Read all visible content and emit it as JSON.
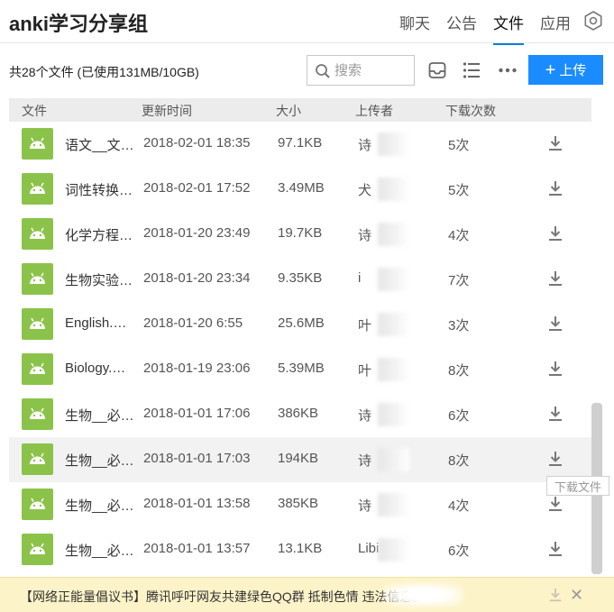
{
  "header": {
    "title": "anki学习分享组",
    "tabs": [
      "聊天",
      "公告",
      "文件",
      "应用"
    ],
    "active_tab": "文件",
    "accent_color": "#0b7fd9"
  },
  "toolbar": {
    "summary": "共28个文件 (已使用131MB/10GB)",
    "search_placeholder": "搜索",
    "upload_label": "上传",
    "upload_color": "#1a8cff",
    "icons": [
      "search-icon",
      "inbox-icon",
      "list-view-icon",
      "more-icon"
    ]
  },
  "columns": {
    "file": "文件",
    "updated": "更新时间",
    "size": "大小",
    "uploader": "上传者",
    "downloads": "下载次数"
  },
  "files": [
    {
      "name": "语文__文…",
      "updated": "2018-02-01 18:35",
      "size": "97.1KB",
      "uploader": "诗",
      "downloads": "5次"
    },
    {
      "name": "词性转换…",
      "updated": "2018-02-01 17:52",
      "size": "3.49MB",
      "uploader": "犬",
      "downloads": "5次"
    },
    {
      "name": "化学方程…",
      "updated": "2018-01-20 23:49",
      "size": "19.7KB",
      "uploader": "诗",
      "downloads": "4次"
    },
    {
      "name": "生物实验…",
      "updated": "2018-01-20 23:34",
      "size": "9.35KB",
      "uploader": "i",
      "downloads": "7次"
    },
    {
      "name": "English.…",
      "updated": "2018-01-20 6:55",
      "size": "25.6MB",
      "uploader": "叶",
      "downloads": "3次"
    },
    {
      "name": "Biology.…",
      "updated": "2018-01-19 23:06",
      "size": "5.39MB",
      "uploader": "叶",
      "downloads": "8次"
    },
    {
      "name": "生物__必…",
      "updated": "2018-01-01 17:06",
      "size": "386KB",
      "uploader": "诗",
      "downloads": "6次"
    },
    {
      "name": "生物__必…",
      "updated": "2018-01-01 17:03",
      "size": "194KB",
      "uploader": "诗",
      "downloads": "8次"
    },
    {
      "name": "生物__必…",
      "updated": "2018-01-01 13:58",
      "size": "385KB",
      "uploader": "诗",
      "downloads": "4次"
    },
    {
      "name": "生物__必…",
      "updated": "2018-01-01 13:57",
      "size": "13.1KB",
      "uploader": "Libi",
      "downloads": "6次"
    }
  ],
  "hovered_row_index": 7,
  "tooltip": "下载文件",
  "file_icon_color": "#8bc34a",
  "notice": {
    "text": "【网络正能量倡议书】腾讯呼吁网友共建绿色QQ群 抵制色情             违法信息。",
    "background": "#fdf3c8",
    "close_label": "✕"
  }
}
